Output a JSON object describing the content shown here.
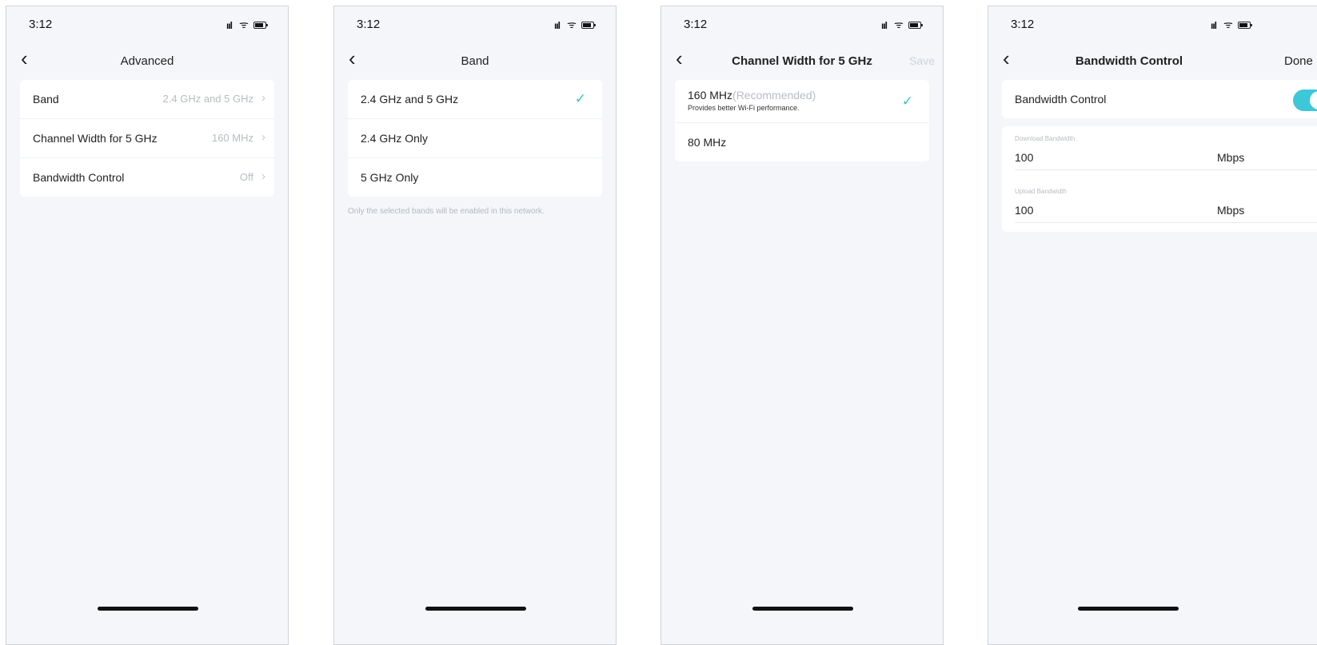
{
  "status_time": "3:12",
  "screens": [
    {
      "title": "Advanced",
      "rows": [
        {
          "label": "Band",
          "value": "2.4 GHz and 5 GHz"
        },
        {
          "label": "Channel Width for 5 GHz",
          "value": "160 MHz"
        },
        {
          "label": "Bandwidth Control",
          "value": "Off"
        }
      ]
    },
    {
      "title": "Band",
      "options": [
        "2.4 GHz and 5 GHz",
        "2.4 GHz Only",
        "5 GHz Only"
      ],
      "selected": "2.4 GHz and 5 GHz",
      "note": "Only the selected bands will be enabled in this network."
    },
    {
      "title": "Channel Width for 5 GHz",
      "save_label": "Save",
      "options": [
        {
          "label": "160 MHz",
          "tag": "(Recommended)",
          "desc": "Provides better Wi-Fi performance.",
          "selected": true
        },
        {
          "label": "80 MHz",
          "selected": false
        }
      ]
    },
    {
      "title": "Bandwidth Control",
      "done_label": "Done",
      "toggle_label": "Bandwidth Control",
      "toggle_on": true,
      "fields": [
        {
          "label": "Download Bandwidth",
          "value": "100",
          "unit": "Mbps"
        },
        {
          "label": "Upload Bandwidth",
          "value": "100",
          "unit": "Mbps"
        }
      ]
    }
  ],
  "colors": {
    "accent": "#3cc0d6",
    "toggle_on": "#3cc8d9",
    "background": "#f4f6fa",
    "muted_text": "#b8bcc2"
  }
}
